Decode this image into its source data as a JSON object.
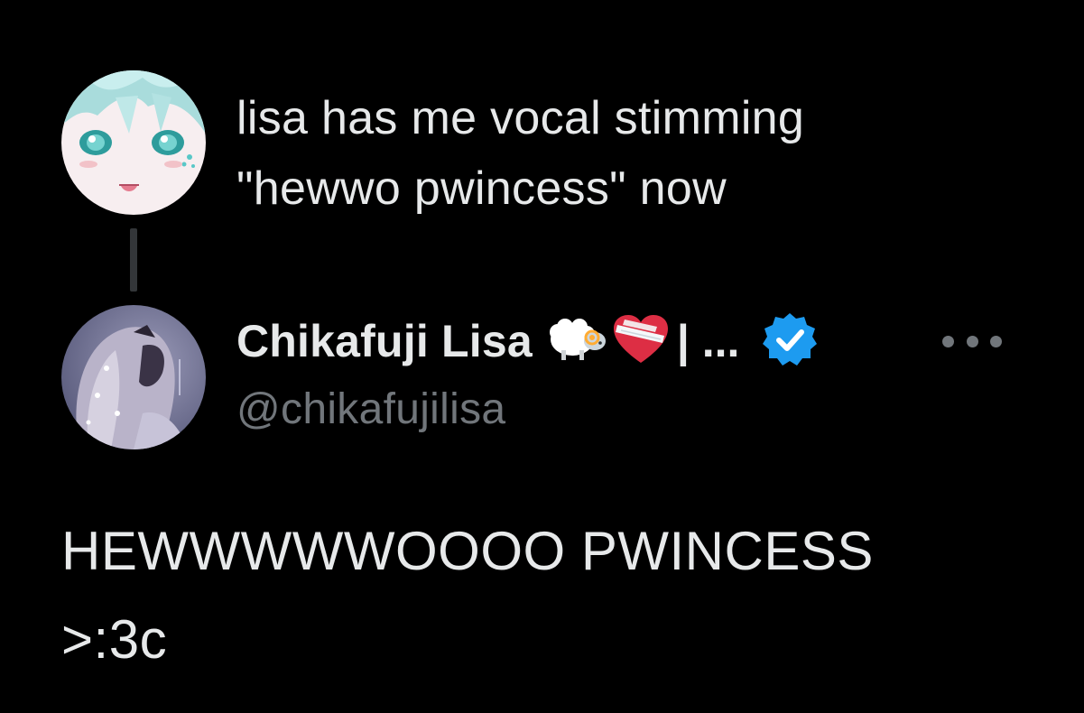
{
  "parent_tweet": {
    "avatar_icon": "anime-avatar-icon",
    "text": "lisa has me vocal stimming\n\"hewwo pwincess\" now"
  },
  "reply_tweet": {
    "author": {
      "display_name": "Chikafuji Lisa",
      "name_emojis": [
        "sheep-emoji-icon",
        "bandaged-heart-emoji-icon"
      ],
      "name_suffix": "| ...",
      "handle": "@chikafujilisa",
      "verified": true,
      "avatar_icon": "anime-avatar-icon"
    },
    "more_icon": "more-dots-icon",
    "text": "HEWWWWWOOOO PWINCESS\n>:3c"
  },
  "colors": {
    "background": "#000000",
    "primary_text": "#e7e9ea",
    "secondary_text": "#71767b",
    "thread_line": "#333639",
    "verified_badge": "#1d9bf0"
  }
}
